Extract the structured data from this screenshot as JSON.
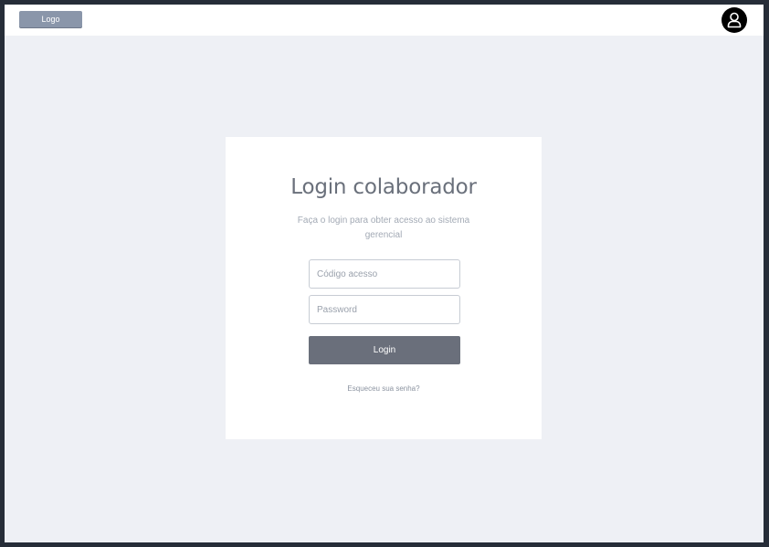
{
  "header": {
    "logo_label": "Logo",
    "avatar_icon": "user-icon"
  },
  "login": {
    "title": "Login colaborador",
    "subtitle": "Faça o login para obter acesso ao sistema gerencial",
    "code_placeholder": "Código acesso",
    "password_placeholder": "Password",
    "button_label": "Login",
    "forgot_label": "Esqueceu sua senha?"
  },
  "colors": {
    "page_background": "#eef0f5",
    "card_background": "#ffffff",
    "button": "#6a6f7b",
    "logo": "#8a96aa"
  }
}
